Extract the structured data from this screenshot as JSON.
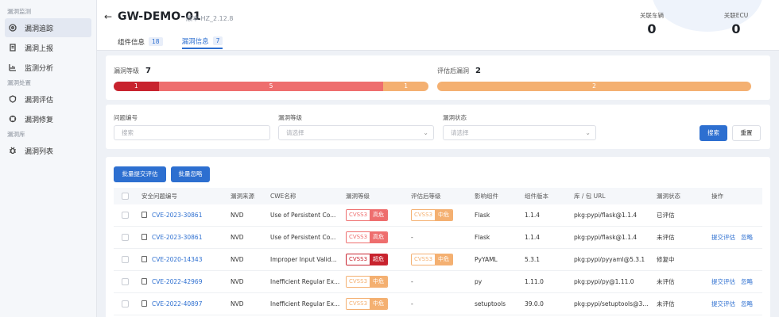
{
  "sidebar": {
    "groups": [
      {
        "title": "漏洞监测",
        "items": [
          {
            "label": "漏洞追踪",
            "icon": "target-icon",
            "active": true
          },
          {
            "label": "漏洞上报",
            "icon": "report-icon"
          },
          {
            "label": "监测分析",
            "icon": "analysis-icon"
          }
        ]
      },
      {
        "title": "漏洞处置",
        "items": [
          {
            "label": "漏洞评估",
            "icon": "shield-icon"
          },
          {
            "label": "漏洞修复",
            "icon": "repair-icon"
          }
        ]
      },
      {
        "title": "漏洞库",
        "items": [
          {
            "label": "漏洞列表",
            "icon": "bug-icon"
          }
        ]
      }
    ]
  },
  "header": {
    "title": "GW-DEMO-01",
    "version": "版本 HZ_2.12.8",
    "tabs": [
      {
        "label": "组件信息",
        "count": "18"
      },
      {
        "label": "漏洞信息",
        "count": "7",
        "active": true
      }
    ],
    "stats": [
      {
        "label": "关联车辆",
        "value": "0"
      },
      {
        "label": "关联ECU",
        "value": "0"
      }
    ]
  },
  "levels": {
    "left_label": "漏洞等级",
    "left_total": "7",
    "right_label": "评估后漏洞",
    "right_total": "2",
    "left_segments": [
      {
        "value": "1",
        "color": "#c8232e"
      },
      {
        "value": "5",
        "color": "#ee6e6e"
      },
      {
        "value": "1",
        "color": "#f4b071"
      }
    ],
    "right_segments": [
      {
        "value": "2",
        "color": "#f4b071"
      }
    ]
  },
  "filter": {
    "fields": [
      {
        "label": "问题编号",
        "placeholder": "搜索"
      },
      {
        "label": "漏洞等级",
        "placeholder": "请选择"
      },
      {
        "label": "漏洞状态",
        "placeholder": "请选择"
      }
    ],
    "search_label": "搜索",
    "reset_label": "重置"
  },
  "table": {
    "batch_submit": "批量提交评估",
    "batch_ignore": "批量忽略",
    "columns": [
      "安全问题编号",
      "漏洞来源",
      "CWE名称",
      "漏洞等级",
      "评估后等级",
      "影响组件",
      "组件版本",
      "库 / 包 URL",
      "漏洞状态",
      "操作"
    ],
    "rows": [
      {
        "id": "CVE-2023-30861",
        "source": "NVD",
        "cwe": "Use of Persistent Co...",
        "level_key": "CVSS3",
        "level": "高危",
        "level_color": "#ee6e6e",
        "eval_key": "CVSS3",
        "eval": "中危",
        "eval_color": "#f4b071",
        "component": "Flask",
        "version": "1.1.4",
        "url": "pkg:pypi/flask@1.1.4",
        "status": "已评估",
        "actions": []
      },
      {
        "id": "CVE-2023-30861",
        "source": "NVD",
        "cwe": "Use of Persistent Co...",
        "level_key": "CVSS3",
        "level": "高危",
        "level_color": "#ee6e6e",
        "eval": "-",
        "component": "Flask",
        "version": "1.1.4",
        "url": "pkg:pypi/flask@1.1.4",
        "status": "未评估",
        "actions": [
          "提交评估",
          "忽略"
        ]
      },
      {
        "id": "CVE-2020-14343",
        "source": "NVD",
        "cwe": "Improper Input Valid...",
        "level_key": "CVSS3",
        "level": "超危",
        "level_color": "#c8232e",
        "eval_key": "CVSS3",
        "eval": "中危",
        "eval_color": "#f4b071",
        "component": "PyYAML",
        "version": "5.3.1",
        "url": "pkg:pypi/pyyaml@5.3.1",
        "status": "修复中",
        "actions": []
      },
      {
        "id": "CVE-2022-42969",
        "source": "NVD",
        "cwe": "Inefficient Regular Ex...",
        "level_key": "CVSS3",
        "level": "中危",
        "level_color": "#f4b071",
        "eval": "-",
        "component": "py",
        "version": "1.11.0",
        "url": "pkg:pypi/py@1.11.0",
        "status": "未评估",
        "actions": [
          "提交评估",
          "忽略"
        ]
      },
      {
        "id": "CVE-2022-40897",
        "source": "NVD",
        "cwe": "Inefficient Regular Ex...",
        "level_key": "CVSS3",
        "level": "中危",
        "level_color": "#f4b071",
        "eval": "-",
        "component": "setuptools",
        "version": "39.0.0",
        "url": "pkg:pypi/setuptools@3...",
        "status": "未评估",
        "actions": [
          "提交评估",
          "忽略"
        ]
      }
    ]
  }
}
